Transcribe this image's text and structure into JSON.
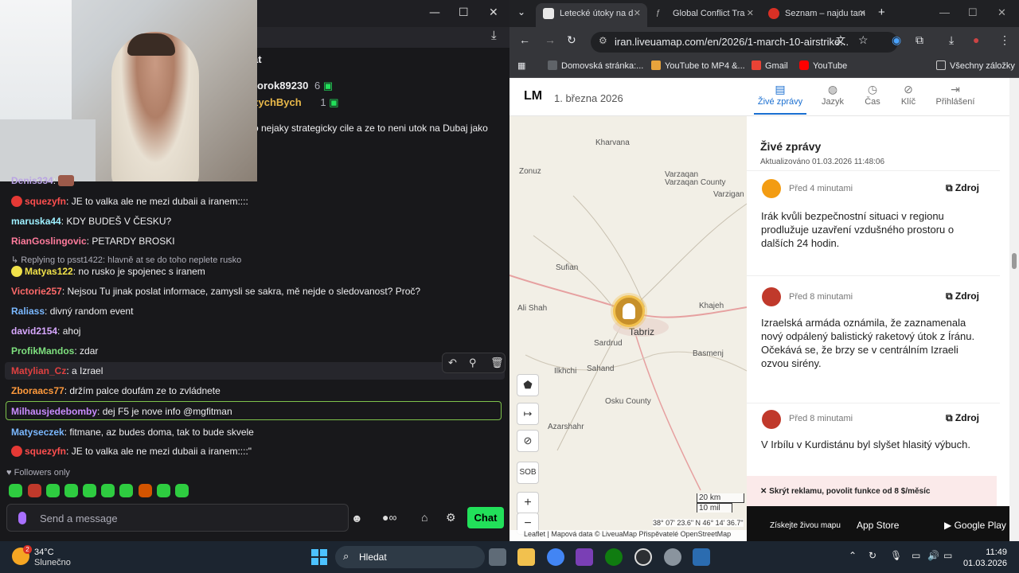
{
  "stream": {
    "pinned": [
      {
        "name": "rorok89230",
        "count": "6"
      },
      {
        "name": "zychBych",
        "count": "1"
      }
    ],
    "header_title": "at",
    "truncated_line": "o nejaky strategicky cile a ze to neni utok na Dubaj jako",
    "messages": [
      {
        "user": "Denis334",
        "text": "",
        "color": "#b9a3e3"
      },
      {
        "user": "squezyfn",
        "text": "JE to valka ale ne mezi dubaii a iranem::::",
        "color": "#ff4f4f"
      },
      {
        "user": "maruska44",
        "text": "KDY BUDEŠ V ČESKU?",
        "color": "#9ef0ff"
      },
      {
        "user": "RianGoslingovic",
        "text": "PETARDY BROSKI",
        "color": "#ff7b9c"
      },
      {
        "user": "Matyas122",
        "text": "no rusko je spojenec s iranem",
        "color": "#f0e14a"
      },
      {
        "user": "Victorie257",
        "text": "Nejsou Tu jinak poslat informace, zamysli se sakra, mě nejde o sledovanost? Proč?",
        "color": "#ff6a6a"
      },
      {
        "user": "Raliass",
        "text": "divný random event",
        "color": "#7ab8ff"
      },
      {
        "user": "david2154",
        "text": "ahoj",
        "color": "#d8a8ff"
      },
      {
        "user": "ProfikMandos",
        "text": "zdar",
        "color": "#7ee07e"
      },
      {
        "user": "Matylian_Cz",
        "text": "a Izrael",
        "color": "#e04040"
      },
      {
        "user": "Zboraacs77",
        "text": "držím palce doufám ze to zvládnete",
        "color": "#ff9a3c"
      },
      {
        "user": "Milhausjedebomby",
        "text": "dej F5 je nove info @mgfitman",
        "color": "#c98cff"
      },
      {
        "user": "Matyseczek",
        "text": "fitmane, az budes doma, tak to bude skvele",
        "color": "#7ab8ff"
      },
      {
        "user": "squezyfn",
        "text": "JE to valka ale ne mezi dubaii a iranem::::\"",
        "color": "#ff4f4f"
      }
    ],
    "reply_context": "Replying to psst1422: hlavně at se do toho neplete rusko",
    "followers_only": "Followers only",
    "input_placeholder": "Send a message",
    "chat_button": "Chat"
  },
  "browser": {
    "tabs": [
      {
        "title": "Letecké útoky na d",
        "active": true,
        "fav_color": "#e8e8e8"
      },
      {
        "title": "Global Conflict Tra",
        "active": false,
        "fav_color": "#202124"
      },
      {
        "title": "Seznam – najdu tam",
        "active": false,
        "fav_color": "#d93025"
      }
    ],
    "url": "iran.liveuamap.com/en/2026/1-march-10-airstrike...",
    "bookmarks": [
      "Domovská stránka:...",
      "YouTube to MP4 &...",
      "Gmail",
      "YouTube"
    ],
    "all_bookmarks": "Všechny záložky"
  },
  "site": {
    "logo": "LM",
    "date": "1. března 2026",
    "nav": [
      {
        "label": "Živé zprávy",
        "icon": "news-icon",
        "active": true
      },
      {
        "label": "Jazyk",
        "icon": "globe-icon",
        "active": false
      },
      {
        "label": "Čas",
        "icon": "clock-icon",
        "active": false
      },
      {
        "label": "Klíč",
        "icon": "compass-icon",
        "active": false
      },
      {
        "label": "Přihlášení",
        "icon": "login-icon",
        "active": false
      }
    ],
    "map_labels": [
      "Kharvana",
      "Zonuz",
      "Varzaqan",
      "Varzaqan County",
      "Varzigan",
      "Sufian",
      "Ali Shah",
      "Tabriz",
      "Khajeh",
      "Sardrud",
      "Basmenj",
      "Sahand",
      "Ilkhchi",
      "Osku County",
      "Azarshahr"
    ],
    "scale_km": "20 km",
    "scale_mi": "10 mil",
    "coords": "38° 07' 23.6\" N 46° 14' 36.7\"",
    "attribution": "Leaflet | Mapová data © LiveuaMap Přispěvatelé OpenStreetMap",
    "feed_title": "Živé zprávy",
    "updated": "Aktualizováno 01.03.2026 11:48:06",
    "source_label": "Zdroj",
    "items": [
      {
        "time": "Před 4 minutami",
        "text": "Irák kvůli bezpečnostní situaci v regionu prodlužuje uzavření vzdušného prostoru o dalších 24 hodin.",
        "icon_color": "#f39c12"
      },
      {
        "time": "Před 8 minutami",
        "text": "Izraelská armáda oznámila, že zaznamenala nový odpálený balistický raketový útok z Íránu. Očekává se, že brzy se v centrálním Izraeli ozvou sirény.",
        "icon_color": "#c0392b"
      },
      {
        "time": "Před 8 minutami",
        "text": "V Irbílu v Kurdistánu byl slyšet hlasitý výbuch.",
        "icon_color": "#c0392b"
      }
    ],
    "ad_text": "✕  Skrýt reklamu, povolit funkce od 8 $/měsíc",
    "footer_cta": "Získejte živou mapu",
    "app_store": "App Store",
    "google_play": "Google Play",
    "map_controls": [
      "SOB",
      "+",
      "−"
    ]
  },
  "taskbar": {
    "weather_temp": "34°C",
    "weather_desc": "Slunečno",
    "weather_badge": "2",
    "search_placeholder": "Hledat",
    "time": "11:49",
    "date": "01.03.2026"
  }
}
